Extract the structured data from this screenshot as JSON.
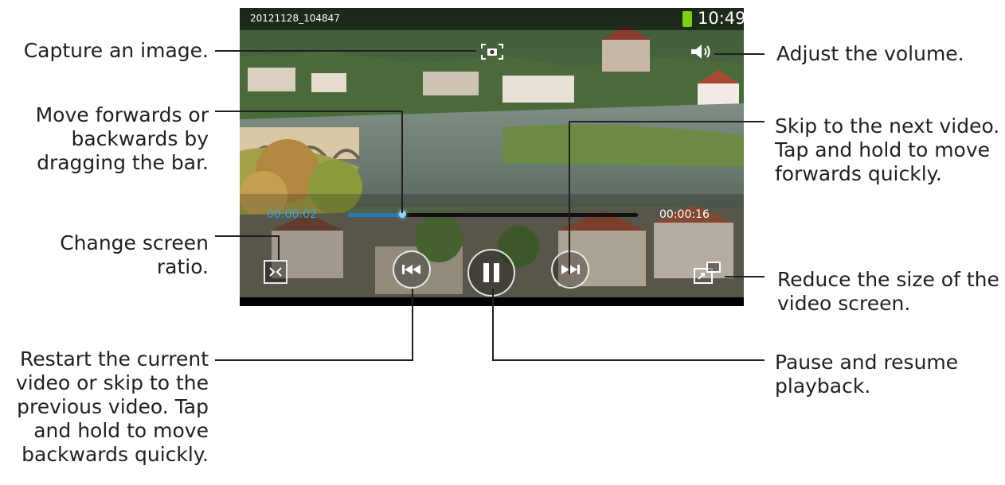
{
  "status_bar": {
    "file_name": "20121128_104847",
    "clock": "10:49"
  },
  "player": {
    "current_time": "00:00:02",
    "total_time": "00:00:16",
    "progress": 0.19
  },
  "callouts": {
    "capture": "Capture an image.",
    "seek": [
      "Move forwards or",
      "backwards by",
      "dragging the bar."
    ],
    "ratio": "Change screen ratio.",
    "previous": [
      "Restart the current",
      "video or skip to the",
      "previous video. Tap",
      "and hold to move",
      "backwards quickly."
    ],
    "volume": "Adjust the volume.",
    "next": [
      "Skip to the next video.",
      "Tap and hold to move",
      "forwards quickly."
    ],
    "popup": [
      "Reduce the size of the",
      "video screen."
    ],
    "pause": [
      "Pause and resume",
      "playback."
    ]
  },
  "icons": {
    "capture": "camera-icon",
    "volume": "speaker-icon",
    "ratio": "screen-ratio-icon",
    "previous": "skip-back-icon",
    "pause": "pause-icon",
    "next": "skip-forward-icon",
    "popup": "pop-up-play-icon",
    "battery": "battery-icon"
  },
  "colors": {
    "accent": "#2fa8e0",
    "battery": "#7dcf17"
  }
}
